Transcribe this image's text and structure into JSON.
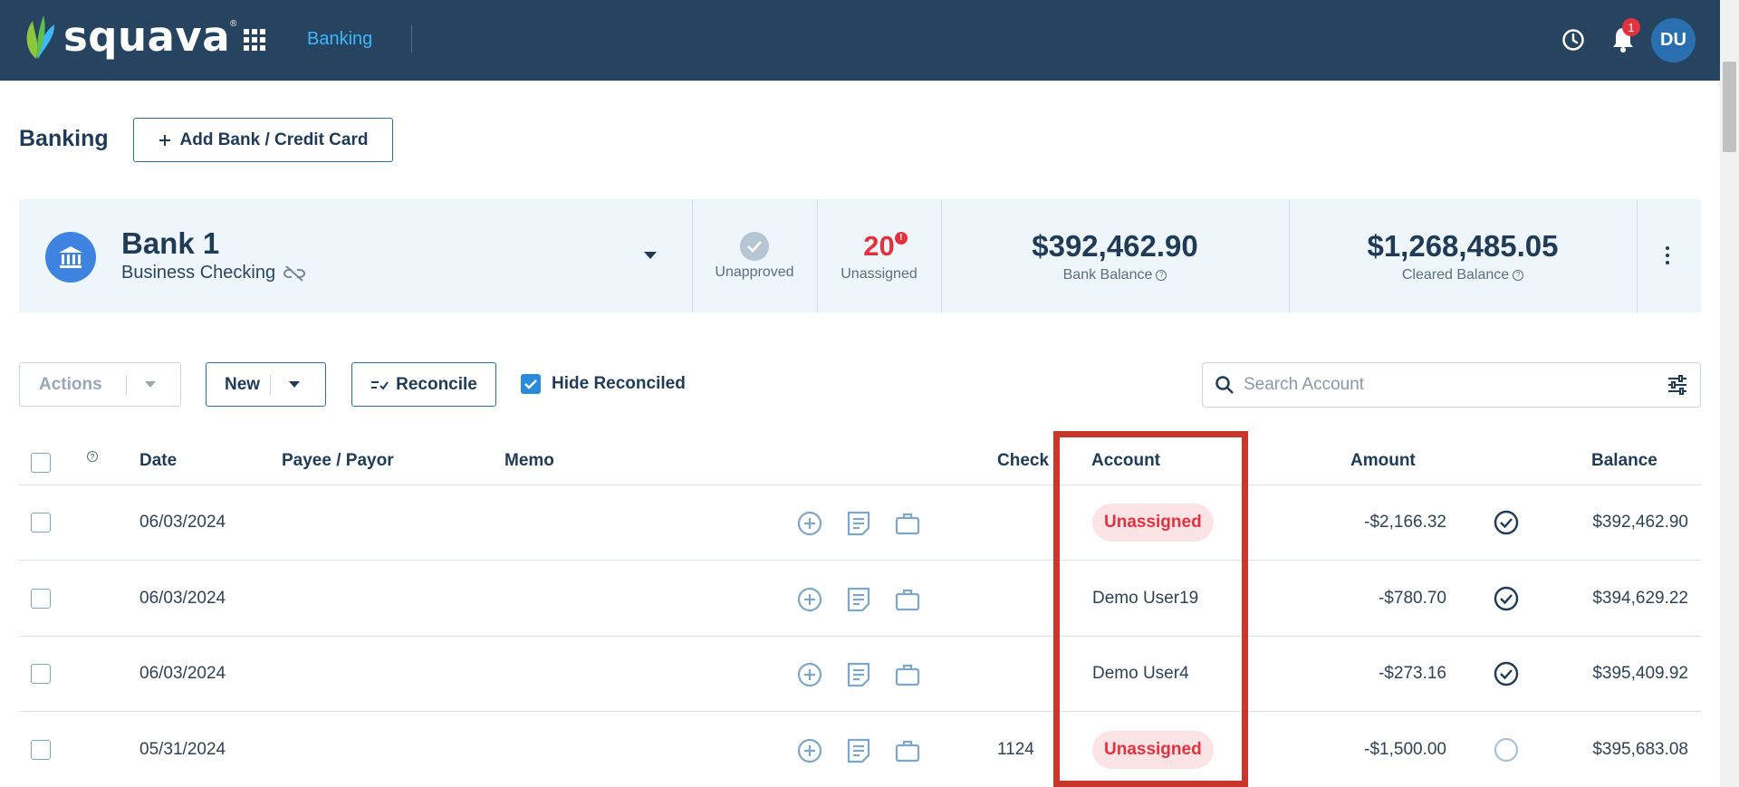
{
  "app": {
    "logo_text": "squava",
    "nav_active": "Banking",
    "notification_count": "1",
    "user_initials": "DU"
  },
  "page": {
    "title": "Banking",
    "add_bank_label": "Add Bank / Credit Card"
  },
  "bank_card": {
    "name": "Bank 1",
    "subtitle": "Business Checking",
    "unapproved_label": "Unapproved",
    "unassigned_count": "20",
    "unassigned_label": "Unassigned",
    "bank_balance": "$392,462.90",
    "bank_balance_label": "Bank Balance",
    "cleared_balance": "$1,268,485.05",
    "cleared_balance_label": "Cleared Balance"
  },
  "toolbar": {
    "actions_label": "Actions",
    "new_label": "New",
    "reconcile_label": "Reconcile",
    "hide_reconciled_label": "Hide Reconciled",
    "hide_reconciled_checked": true,
    "search_placeholder": "Search Account"
  },
  "table": {
    "columns": {
      "date": "Date",
      "payee": "Payee / Payor",
      "memo": "Memo",
      "check": "Check",
      "account": "Account",
      "amount": "Amount",
      "balance": "Balance"
    },
    "rows": [
      {
        "date": "06/03/2024",
        "payee": "",
        "memo": "",
        "check": "",
        "account": "Unassigned",
        "account_unassigned": true,
        "amount": "-$2,166.32",
        "reconciled": true,
        "balance": "$392,462.90"
      },
      {
        "date": "06/03/2024",
        "payee": "",
        "memo": "",
        "check": "",
        "account": "Demo User19",
        "account_unassigned": false,
        "amount": "-$780.70",
        "reconciled": true,
        "balance": "$394,629.22"
      },
      {
        "date": "06/03/2024",
        "payee": "",
        "memo": "",
        "check": "",
        "account": "Demo User4",
        "account_unassigned": false,
        "amount": "-$273.16",
        "reconciled": true,
        "balance": "$395,409.92"
      },
      {
        "date": "05/31/2024",
        "payee": "",
        "memo": "",
        "check": "1124",
        "account": "Unassigned",
        "account_unassigned": true,
        "amount": "-$1,500.00",
        "reconciled": false,
        "balance": "$395,683.08"
      }
    ]
  },
  "colors": {
    "topbar": "#26445f",
    "accent": "#3fb7ff",
    "primary_text": "#1f3b55",
    "unassigned": "#e2323d",
    "highlight_box": "#c9372c"
  }
}
